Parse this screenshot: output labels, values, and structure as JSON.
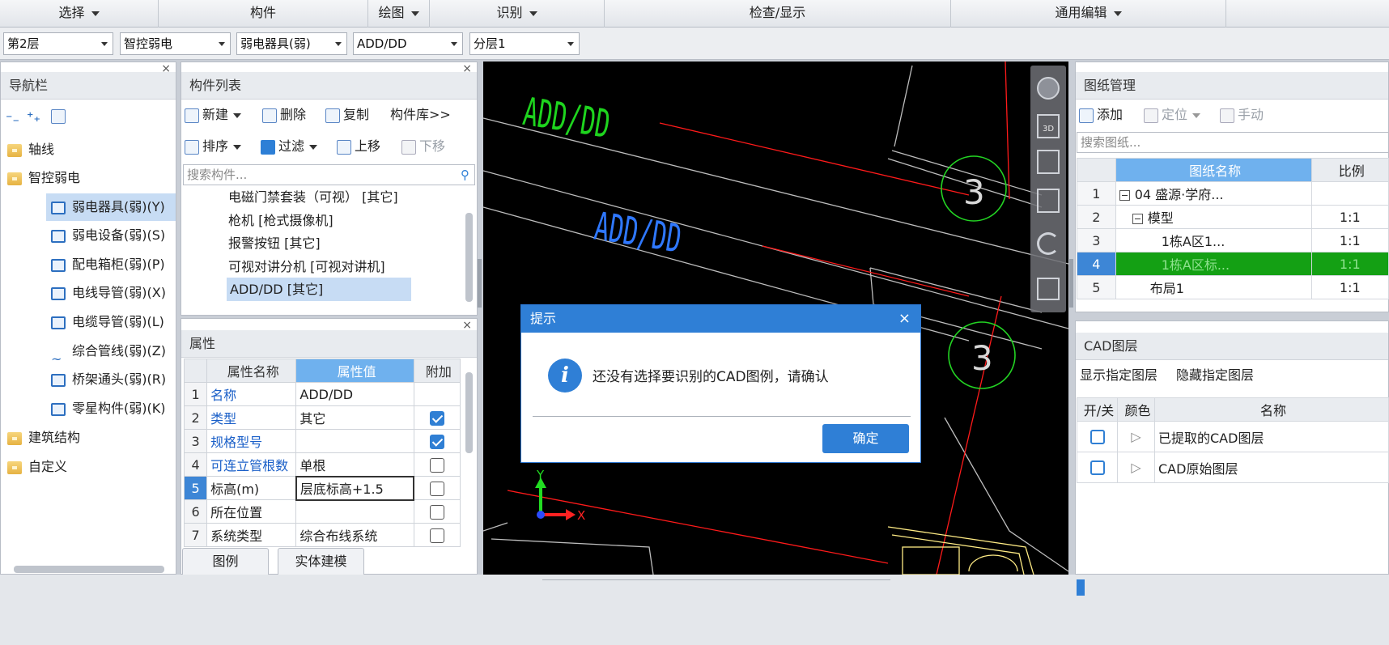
{
  "ribbon": {
    "groups": [
      "选择",
      "构件",
      "绘图",
      "识别",
      "检查/显示",
      "通用编辑"
    ]
  },
  "selectors": {
    "floor": "第2层",
    "specialty": "智控弱电",
    "component_type": "弱电器具(弱)",
    "component": "ADD/DD",
    "layer": "分层1"
  },
  "nav": {
    "title": "导航栏",
    "close": "×",
    "items": [
      "轴线",
      "智控弱电",
      "弱电器具(弱)(Y)",
      "弱电设备(弱)(S)",
      "配电箱柜(弱)(P)",
      "电线导管(弱)(X)",
      "电缆导管(弱)(L)",
      "综合管线(弱)(Z)",
      "桥架通头(弱)(R)",
      "零星构件(弱)(K)",
      "建筑结构",
      "自定义"
    ]
  },
  "component_list": {
    "title": "构件列表",
    "close": "×",
    "toolbar": {
      "new": "新建",
      "delete": "删除",
      "copy": "复制",
      "library": "构件库>>",
      "sort": "排序",
      "filter": "过滤",
      "up": "上移",
      "down": "下移"
    },
    "search_placeholder": "搜索构件...",
    "items": [
      "电磁门禁套装（可视） [其它]",
      "枪机 [枪式摄像机]",
      "报警按钮 [其它]",
      "可视对讲分机 [可视对讲机]",
      "ADD/DD [其它]"
    ]
  },
  "properties": {
    "title": "属性",
    "close": "×",
    "headers": [
      "属性名称",
      "属性值",
      "附加"
    ],
    "rows": [
      {
        "num": "1",
        "name": "名称",
        "value": "ADD/DD"
      },
      {
        "num": "2",
        "name": "类型",
        "value": "其它"
      },
      {
        "num": "3",
        "name": "规格型号",
        "value": ""
      },
      {
        "num": "4",
        "name": "可连立管根数",
        "value": "单根"
      },
      {
        "num": "5",
        "name": "标高(m)",
        "value": "层底标高+1.5"
      },
      {
        "num": "6",
        "name": "所在位置",
        "value": ""
      },
      {
        "num": "7",
        "name": "系统类型",
        "value": "综合布线系统"
      }
    ],
    "checked": [
      false,
      true,
      true,
      false,
      false,
      false,
      false
    ],
    "tabs": [
      "图例",
      "实体建模"
    ]
  },
  "canvas": {
    "labels": [
      "ADD/DD",
      "ADD/DD"
    ],
    "circle_labels": [
      "3",
      "3"
    ],
    "axis_y": "Y",
    "axis_x": "X",
    "view_3d": "3D"
  },
  "dialog": {
    "title": "提示",
    "close": "×",
    "message": "还没有选择要识别的CAD图例，请确认",
    "ok": "确定",
    "info_glyph": "i"
  },
  "drawings": {
    "title": "图纸管理",
    "toolbar": {
      "add": "添加",
      "locate": "定位",
      "manual": "手动"
    },
    "search_placeholder": "搜索图纸...",
    "headers": [
      "图纸名称",
      "比例"
    ],
    "rows": [
      {
        "num": "1",
        "name": "04 盛源·学府...",
        "scale": ""
      },
      {
        "num": "2",
        "name": "模型",
        "scale": "1:1"
      },
      {
        "num": "3",
        "name": "1栋A区1...",
        "scale": "1:1"
      },
      {
        "num": "4",
        "name": "1栋A区标...",
        "scale": "1:1"
      },
      {
        "num": "5",
        "name": "布局1",
        "scale": "1:1"
      }
    ]
  },
  "cad_layers": {
    "title": "CAD图层",
    "show_btn": "显示指定图层",
    "hide_btn": "隐藏指定图层",
    "headers": [
      "开/关",
      "颜色",
      "名称"
    ],
    "rows": [
      "已提取的CAD图层",
      "CAD原始图层"
    ]
  }
}
